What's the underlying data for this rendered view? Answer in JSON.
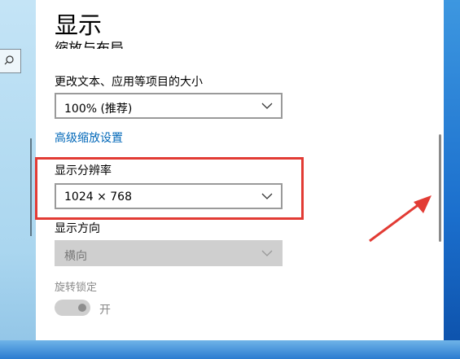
{
  "window": {
    "title": "显示"
  },
  "section": {
    "heading": "缩放与布局"
  },
  "scale": {
    "label": "更改文本、应用等项目的大小",
    "value": "100% (推荐)"
  },
  "advanced_link": "高级缩放设置",
  "resolution": {
    "label": "显示分辨率",
    "value": "1024 × 768"
  },
  "orientation": {
    "label": "显示方向",
    "value": "横向"
  },
  "rotation_lock": {
    "label": "旋转锁定",
    "state": "开"
  },
  "colors": {
    "accent_link": "#0067b8",
    "highlight": "#e23b34"
  }
}
